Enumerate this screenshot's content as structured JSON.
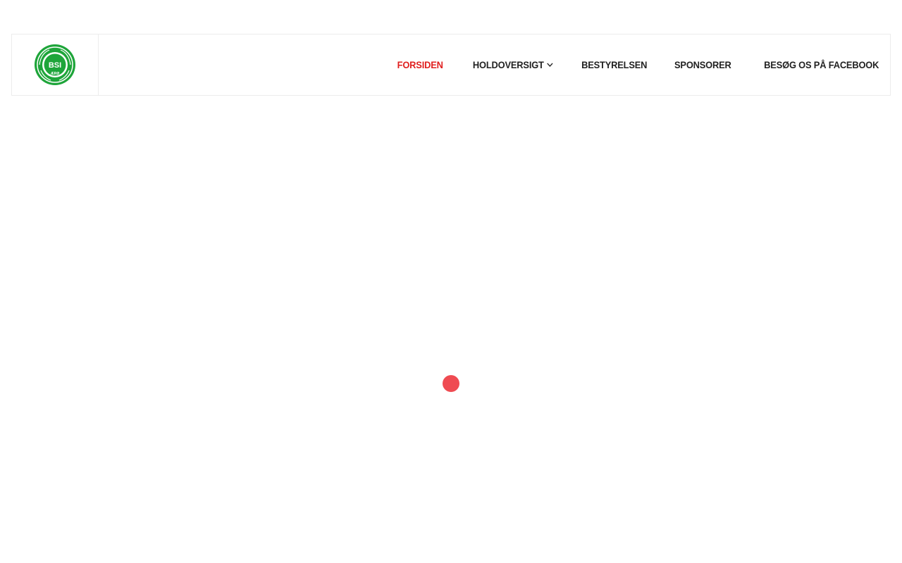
{
  "logo": {
    "icon": "club-crest-icon",
    "text_top": "BSI",
    "text_bottom": "ÆRØ",
    "color": "#1ea53a"
  },
  "nav": {
    "items": [
      {
        "label": "FORSIDEN",
        "active": true
      },
      {
        "label": "HOLDOVERSIGT",
        "has_dropdown": true,
        "icon": "chevron-down-icon"
      },
      {
        "label": "BESTYRELSEN"
      },
      {
        "label": "SPONSORER"
      },
      {
        "label": "BESØG OS PÅ FACEBOOK"
      }
    ],
    "active_color": "#e0201f",
    "text_color": "#222222"
  },
  "loader": {
    "icon": "loading-spinner-icon",
    "color": "#ef4b52"
  }
}
